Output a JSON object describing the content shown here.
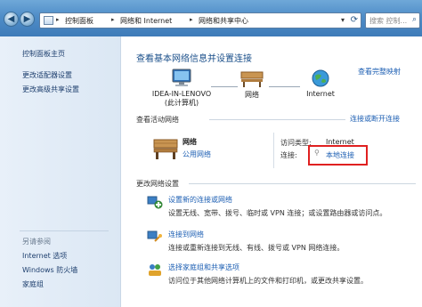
{
  "window": {
    "breadcrumbs": [
      "控制面板",
      "网络和 Internet",
      "网络和共享中心"
    ],
    "search_placeholder": "搜索 控制..."
  },
  "sidebar": {
    "items": [
      {
        "label": "控制面板主页"
      },
      {
        "label": "更改适配器设置"
      },
      {
        "label": "更改高级共享设置"
      }
    ],
    "see_also_title": "另请参阅",
    "see_also": [
      {
        "label": "Internet 选项"
      },
      {
        "label": "Windows 防火墙"
      },
      {
        "label": "家庭组"
      }
    ]
  },
  "main": {
    "heading": "查看基本网络信息并设置连接",
    "view_full_map": "查看完整映射",
    "map": {
      "computer_name": "IDEA-IN-LENOVO",
      "computer_sub": "(此计算机)",
      "network": "网络",
      "internet": "Internet"
    },
    "active": {
      "title": "查看活动网络",
      "connect_link": "连接或断开连接",
      "network_name": "网络",
      "network_type": "公用网络",
      "access_key": "访问类型:",
      "access_val": "Internet",
      "conn_key": "连接:",
      "conn_val": "本地连接"
    },
    "change": {
      "title": "更改网络设置",
      "tasks": [
        {
          "title": "设置新的连接或网络",
          "desc": "设置无线、宽带、拨号、临时或 VPN 连接；或设置路由器或访问点。",
          "icon": "network-setup-icon"
        },
        {
          "title": "连接到网络",
          "desc": "连接或重新连接到无线、有线、拨号或 VPN 网络连接。",
          "icon": "connect-network-icon"
        },
        {
          "title": "选择家庭组和共享选项",
          "desc": "访问位于其他网络计算机上的文件和打印机，或更改共享设置。",
          "icon": "homegroup-icon"
        }
      ]
    }
  },
  "colors": {
    "link": "#1d5fb3",
    "heading": "#1a4f8a",
    "highlight_box": "#e02020",
    "titlebar": "#4f8dc8"
  }
}
